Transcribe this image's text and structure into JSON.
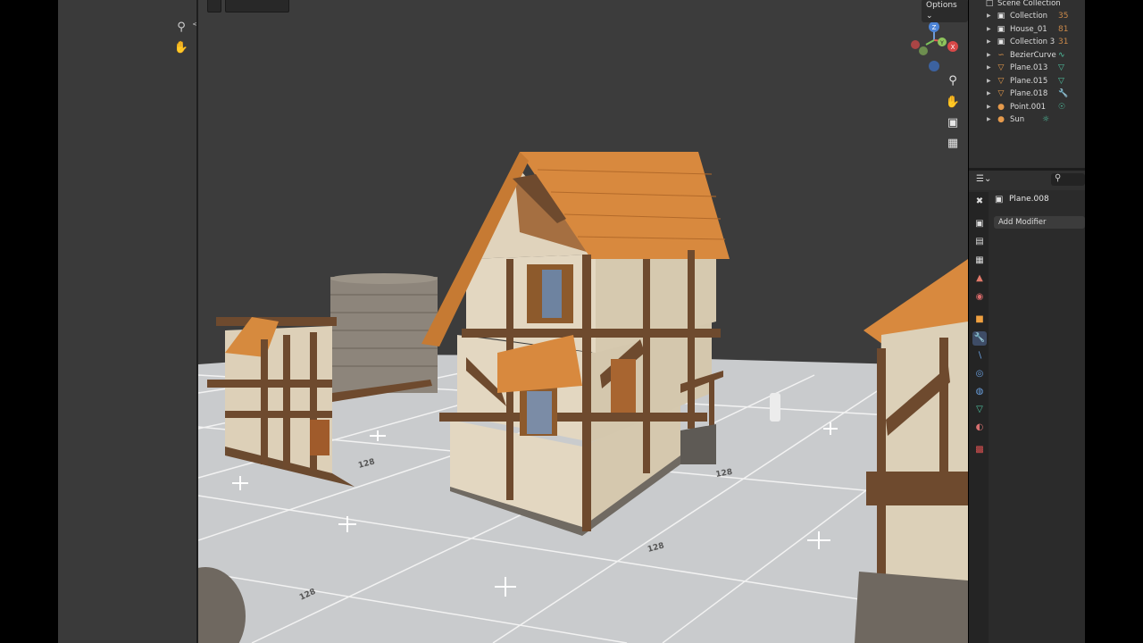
{
  "viewport": {
    "options_label": "Options",
    "grid_label": "128",
    "gizmo": {
      "z": "Z",
      "y": "Y",
      "x": "X"
    }
  },
  "outliner": {
    "header": "Scene Collection",
    "items": [
      {
        "name": "Collection",
        "type": "collection-icon",
        "badge": "35"
      },
      {
        "name": "House_01",
        "type": "collection-icon",
        "badge": "81"
      },
      {
        "name": "Collection 3",
        "type": "collection-icon",
        "badge": "31"
      },
      {
        "name": "BezierCurve",
        "type": "curve-icon",
        "badge": ""
      },
      {
        "name": "Plane.013",
        "type": "mesh-icon",
        "badge": ""
      },
      {
        "name": "Plane.015",
        "type": "mesh-icon",
        "badge": ""
      },
      {
        "name": "Plane.018",
        "type": "mesh-icon",
        "badge": ""
      },
      {
        "name": "Point.001",
        "type": "light-icon",
        "badge": ""
      },
      {
        "name": "Sun",
        "type": "light-icon",
        "badge": ""
      }
    ]
  },
  "properties": {
    "object_name": "Plane.008",
    "add_modifier_label": "Add Modifier"
  },
  "colors": {
    "viewport_bg": "#3c3c3c",
    "floor": "#c9cbcd",
    "roof": "#d8893e",
    "timber": "#6e4a2e",
    "plaster": "#e3d7c1"
  }
}
